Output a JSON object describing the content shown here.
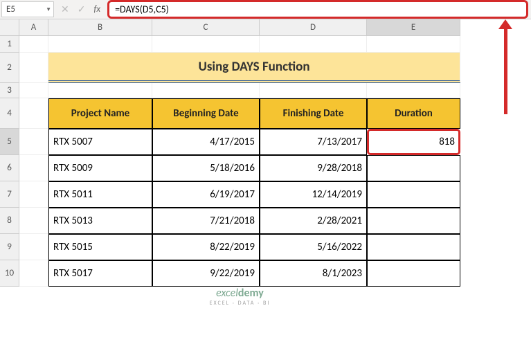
{
  "name_box": "E5",
  "formula": "=DAYS(D5,C5)",
  "cols": {
    "A": "A",
    "B": "B",
    "C": "C",
    "D": "D",
    "E": "E"
  },
  "rows": [
    "1",
    "2",
    "3",
    "4",
    "5",
    "6",
    "7",
    "8",
    "9",
    "10"
  ],
  "title": "Using DAYS Function",
  "headers": {
    "project": "Project Name",
    "begin": "Beginning Date",
    "finish": "Finishing Date",
    "duration": "Duration"
  },
  "chart_data": {
    "type": "table",
    "title": "Using DAYS Function",
    "columns": [
      "Project Name",
      "Beginning Date",
      "Finishing Date",
      "Duration"
    ],
    "rows": [
      {
        "project": "RTX 5007",
        "begin": "4/17/2015",
        "finish": "7/13/2017",
        "duration": "818"
      },
      {
        "project": "RTX 5009",
        "begin": "5/18/2016",
        "finish": "9/28/2018",
        "duration": ""
      },
      {
        "project": "RTX 5011",
        "begin": "6/19/2017",
        "finish": "12/14/2019",
        "duration": ""
      },
      {
        "project": "RTX 5013",
        "begin": "7/21/2018",
        "finish": "2/28/2021",
        "duration": ""
      },
      {
        "project": "RTX 5015",
        "begin": "8/22/2019",
        "finish": "5/16/2022",
        "duration": ""
      },
      {
        "project": "RTX 5017",
        "begin": "9/22/2019",
        "finish": "8/1/2023",
        "duration": ""
      }
    ]
  },
  "watermark": {
    "brand1": "excel",
    "brand2": "demy",
    "tag": "EXCEL · DATA · BI"
  }
}
